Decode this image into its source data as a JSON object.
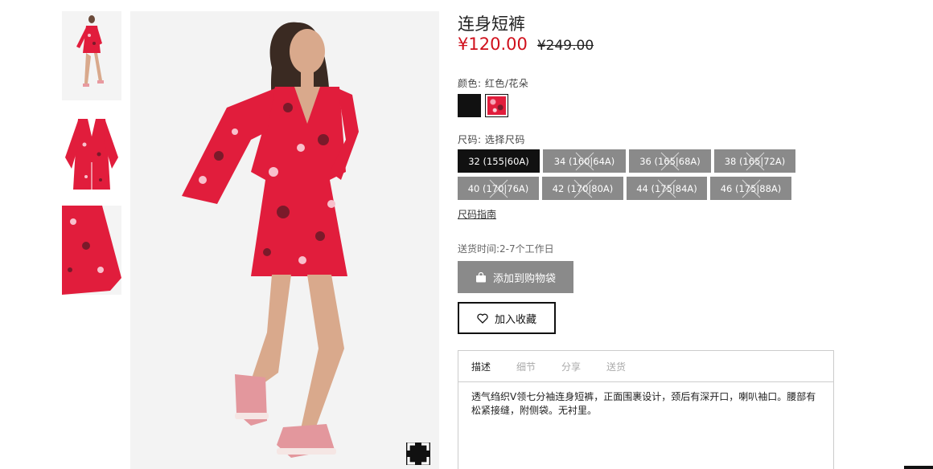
{
  "product": {
    "title": "连身短裤",
    "price": "¥120.00",
    "old_price": "¥249.00"
  },
  "color": {
    "label": "颜色: 红色/花朵",
    "swatches": [
      {
        "name": "black",
        "hex": "#111111"
      },
      {
        "name": "floral-red",
        "hex": "#e11d3c"
      }
    ]
  },
  "size": {
    "label": "尺码: 选择尺码",
    "options": [
      {
        "label": "32 (155|60A)",
        "available": true,
        "selected": true
      },
      {
        "label": "34 (160|64A)",
        "available": false
      },
      {
        "label": "36 (165|68A)",
        "available": false
      },
      {
        "label": "38 (165|72A)",
        "available": false
      },
      {
        "label": "40 (170|76A)",
        "available": false
      },
      {
        "label": "42 (170|80A)",
        "available": false
      },
      {
        "label": "44 (175|84A)",
        "available": false
      },
      {
        "label": "46 (175|88A)",
        "available": false
      }
    ],
    "guide_label": "尺码指南"
  },
  "delivery": "送货时间:2-7个工作日",
  "actions": {
    "add_to_bag": "添加到购物袋",
    "favorite": "加入收藏"
  },
  "tabs": {
    "items": [
      "描述",
      "细节",
      "分享",
      "送货"
    ],
    "active": "描述",
    "description": "透气绉织V领七分袖连身短裤，正面围裹设计，颈后有深开口，喇叭袖口。腰部有松紧接缝，附侧袋。无衬里。"
  },
  "icons": {
    "zoom": "fullscreen-icon",
    "bag": "shopping-bag-icon",
    "heart": "heart-icon"
  },
  "colors": {
    "accent_price": "#d0101c",
    "button_gray": "#8a8a8a",
    "dress_red": "#e11d3c"
  }
}
